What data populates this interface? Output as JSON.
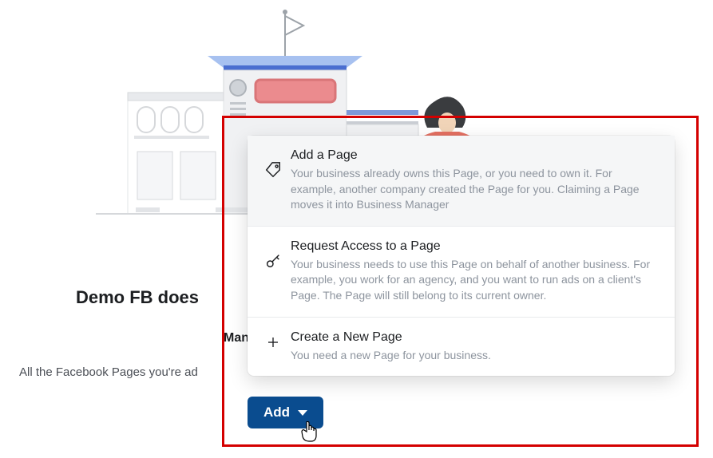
{
  "heading": "Demo FB does",
  "subheading": "Man",
  "description": "All the Facebook Pages you're ad",
  "menu": {
    "items": [
      {
        "title": "Add a Page",
        "desc": "Your business already owns this Page, or you need to own it. For example, another company created the Page for you. Claiming a Page moves it into Business Manager"
      },
      {
        "title": "Request Access to a Page",
        "desc": "Your business needs to use this Page on behalf of another business. For example, you work for an agency, and you want to run ads on a client's Page. The Page will still belong to its current owner."
      },
      {
        "title": "Create a New Page",
        "desc": "You need a new Page for your business."
      }
    ]
  },
  "button": {
    "label": "Add"
  }
}
